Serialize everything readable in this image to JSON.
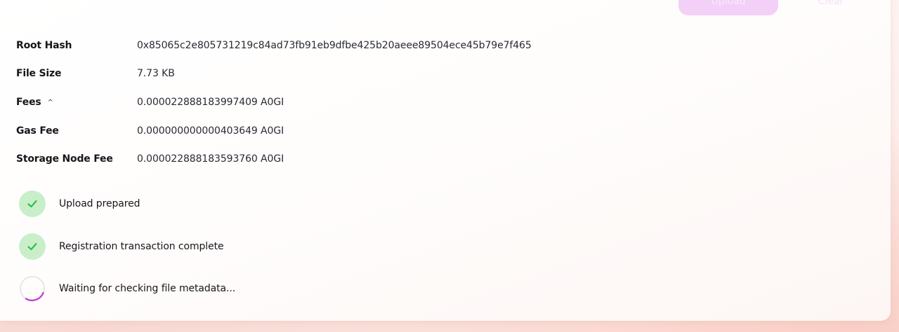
{
  "actions": {
    "upload_label": "Upload",
    "clear_label": "Clear"
  },
  "details": [
    {
      "label": "Root Hash",
      "value": "0x85065c2e805731219c84ad73fb91eb9dfbe425b20aeee89504ece45b79e7f465"
    },
    {
      "label": "File Size",
      "value": "7.73 KB"
    },
    {
      "label": "Fees",
      "value": "0.000022888183997409 A0GI",
      "toggle_icon": "chevron-up-icon",
      "toggle_glyph": "^"
    },
    {
      "label": "Gas Fee",
      "value": "0.000000000000403649 A0GI"
    },
    {
      "label": "Storage Node Fee",
      "value": "0.000022888183593760 A0GI"
    }
  ],
  "steps": [
    {
      "label": "Upload prepared",
      "status": "complete",
      "icon": "check-icon"
    },
    {
      "label": "Registration transaction complete",
      "status": "complete",
      "icon": "check-icon"
    },
    {
      "label": "Waiting for checking file metadata...",
      "status": "in-progress",
      "icon": "spinner-icon"
    }
  ],
  "colors": {
    "accent": "#f3d0f7",
    "success_bg": "#c8efc9",
    "success_check": "#2fbd4e",
    "spinner_arc": "#c53fd6",
    "spinner_track": "#e6e6ea"
  }
}
